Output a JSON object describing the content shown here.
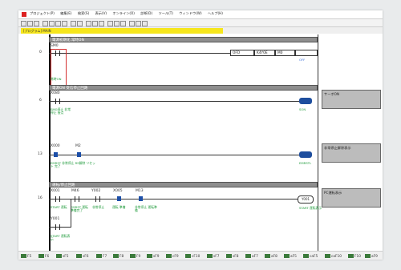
{
  "menu": [
    "プロジェクト(P)",
    "編集(E)",
    "検索(S)",
    "表示(V)",
    "オンライン(O)",
    "診断(D)",
    "ツール(T)",
    "ウィンドウ(W)",
    "ヘルプ(H)"
  ],
  "tab": {
    "label": "[プログラム] MAIN"
  },
  "headers": {
    "h1": "電源初期化 常時ON",
    "h2": "電源ON 受信停止回路",
    "h3": "運転/停止回路"
  },
  "rung1": {
    "step": "0",
    "contact_label": "SM0",
    "cmd": "OFD",
    "arg1": "K4Y0E",
    "arg2": "M0",
    "device_comment": "OFF",
    "green": "常時ON"
  },
  "rung2": {
    "step": "6",
    "contact_label": "X080",
    "coil_label": "SON",
    "green": "EMG停止 非常停止 接点",
    "note": "サーボON"
  },
  "rung3": {
    "step": "13",
    "c1": "X000",
    "c2": "M2",
    "coil_label": "EMRSTL",
    "green": "EMRST 非常停止 RS解除 リセット 完了",
    "note": "非常停止解除表示"
  },
  "rung4": {
    "step": "16",
    "c1": "X001",
    "c2": "M46",
    "c3": "Y002",
    "c4": "X005",
    "c5": "M13",
    "coil": "Y001",
    "coil_green": "START 運転表示",
    "green1": "START 運転",
    "green2": "EMRST 運転 準備完了",
    "green3": "非常停止",
    "green4": "運転 準備",
    "green5": "非常停止 運転準備",
    "branch_contact": "Y001",
    "branch_green": "START 運転表示",
    "note": "PC運転表示"
  },
  "bottom": [
    "F5",
    "F6",
    "sF5",
    "sF6",
    "F7",
    "F8",
    "F9",
    "sF9",
    "cF9",
    "cF10",
    "sF7",
    "sF8",
    "aF7",
    "aF8",
    "aF5",
    "caF5",
    "caF10",
    "F10",
    "aF9"
  ]
}
